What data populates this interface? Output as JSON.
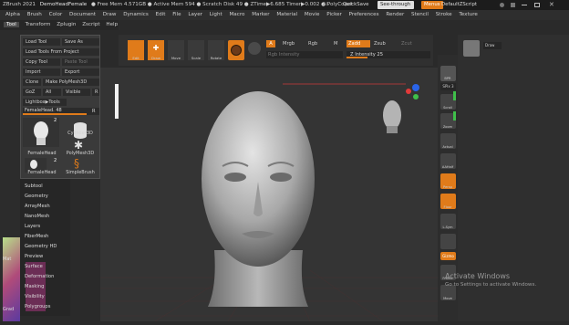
{
  "titlebar": {
    "app": "ZBrush 2021",
    "doc": "DemoHeadFemale",
    "stats": "● Free Mem 4.571GB ● Active Mem 594 ● Scratch Disk 49 ● ZTime▶6.685 Timer▶0.002 ● PolyCount",
    "ac": "AC",
    "quicksave": "QuickSave",
    "seethrough": "See-through  0",
    "menus": "Menus",
    "defaultscript": "DefaultZScript"
  },
  "menubar": [
    "Alpha",
    "Brush",
    "Color",
    "Document",
    "Draw",
    "Dynamics",
    "Edit",
    "File",
    "Layer",
    "Light",
    "Macro",
    "Marker",
    "Material",
    "Movie",
    "Picker",
    "Preferences",
    "Render",
    "Stencil",
    "Stroke",
    "Texture"
  ],
  "tabbar": [
    "Tool",
    "Transform",
    "Zplugin",
    "Zscript",
    "Help"
  ],
  "toolpanel": {
    "load_tool": "Load Tool",
    "save_as": "Save As",
    "load_from_project": "Load Tools From Project",
    "copy_tool": "Copy Tool",
    "paste_tool": "Paste Tool",
    "import": "Import",
    "export": "Export",
    "clone": "Clone",
    "make_polymesh": "Make PolyMesh3D",
    "goz": "GoZ",
    "all": "All",
    "visible": "Visible",
    "r": "R",
    "lightbox": "Lightbox▶Tools",
    "slider_label": "FemaleHead. 48",
    "slider_value": 0.85,
    "slider_r": "R",
    "thumbs": [
      {
        "label": "FemaleHead",
        "count": "2"
      },
      {
        "label": "Cylinder3D",
        "count": ""
      },
      {
        "label": "PolyMesh3D",
        "count": ""
      },
      {
        "label": "FemaleHead",
        "count": "2"
      },
      {
        "label": "SimpleBrush",
        "count": ""
      }
    ]
  },
  "lower_menu": [
    "Subtool",
    "Geometry",
    "ArrayMesh",
    "NanoMesh",
    "Layers",
    "FiberMesh",
    "Geometry HD",
    "Preview",
    "Surface",
    "Deformation",
    "Masking",
    "Visibility",
    "Polygroups"
  ],
  "left_labels": {
    "gradient": "Grad",
    "mat": "Mat"
  },
  "toolbar": {
    "icons": [
      "Edit",
      "Draw",
      "Move",
      "Scale",
      "Rotate"
    ],
    "a_label": "A",
    "mrgb": "Mrgb",
    "rgb": "Rgb",
    "m": "M",
    "zadd": "Zadd",
    "zsub": "Zsub",
    "zcut": "Zcut",
    "rgb_intensity": "Rgb Intensity",
    "z_intensity": "Z Intensity 25",
    "z_intensity_value": 0.25,
    "focal": "Focal",
    "draw_size": "Draw"
  },
  "right_shelf": [
    "BPR",
    "SPix 3",
    "Scroll",
    "Zoom",
    "Actual",
    "AAHalf",
    "Persp",
    "Floor",
    "L.Sym",
    "Gizmo",
    "Frame",
    "Move"
  ],
  "watermark": {
    "title": "Activate Windows",
    "sub": "Go to Settings to activate Windows."
  },
  "colors": {
    "accent": "#e07b1a",
    "bg": "#2a2a2a",
    "green": "#3fbf4a"
  }
}
